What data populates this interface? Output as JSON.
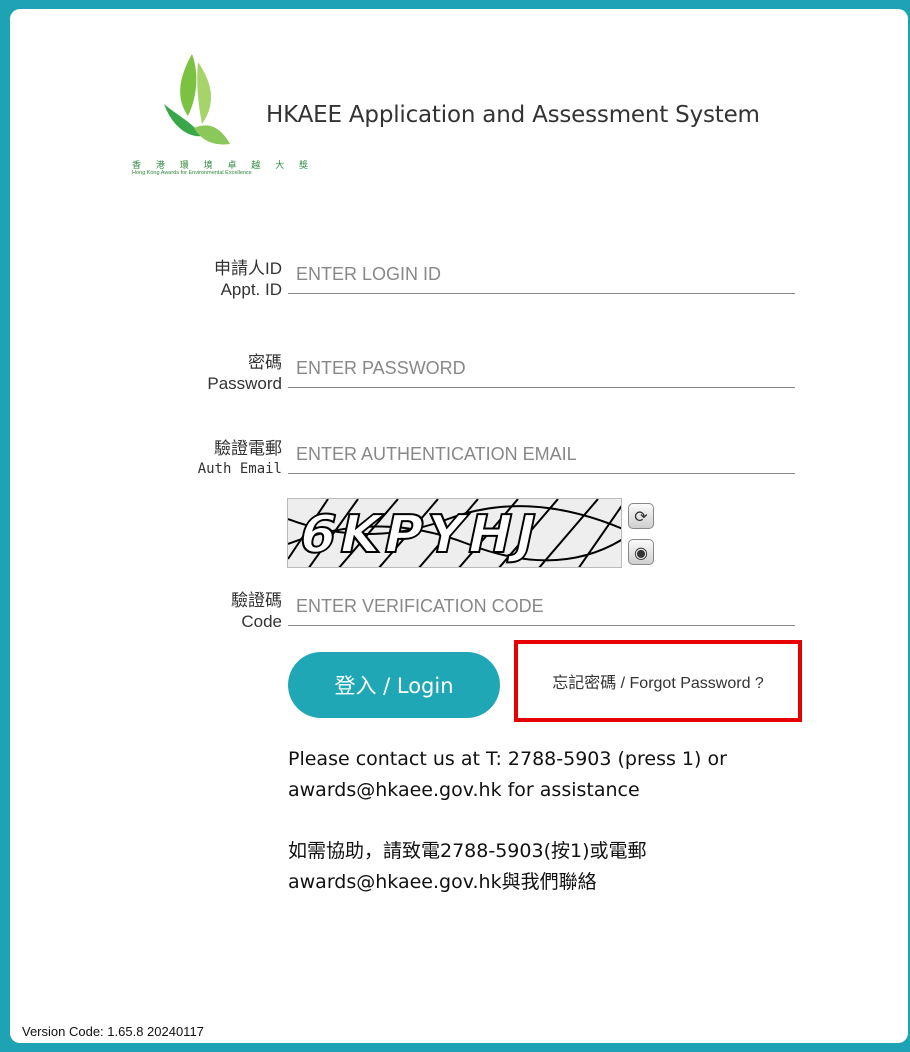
{
  "header": {
    "logo_cn": "香 港 環 境 卓 越 大 獎",
    "logo_en": "Hong Kong Awards for Environmental Excellence",
    "title": "HKAEE Application and Assessment System"
  },
  "form": {
    "login_id": {
      "label_cn": "申請人ID",
      "label_en": "Appt. ID",
      "placeholder": "ENTER LOGIN ID"
    },
    "password": {
      "label_cn": "密碼",
      "label_en": "Password",
      "placeholder": "ENTER PASSWORD"
    },
    "auth_email": {
      "label_cn": "驗證電郵",
      "label_en": "Auth Email",
      "placeholder": "ENTER AUTHENTICATION EMAIL"
    },
    "captcha": {
      "text": "6KPYHJ",
      "refresh_icon": "refresh-icon",
      "audio_icon": "audio-icon"
    },
    "code": {
      "label_cn": "驗證碼",
      "label_en": "Code",
      "placeholder": "ENTER VERIFICATION CODE"
    },
    "login_button": "登入 / Login",
    "forgot_link": "忘記密碼 / Forgot Password ?"
  },
  "contact": {
    "en_line1": "Please contact us at T: 2788-5903 (press 1) or",
    "en_line2": "awards@hkaee.gov.hk for assistance",
    "cn_line1": "如需協助，請致電2788-5903(按1)或電郵",
    "cn_line2": "awards@hkaee.gov.hk與我們聯絡"
  },
  "footer": {
    "version": "Version Code: 1.65.8 20240117"
  },
  "colors": {
    "frame": "#1ea3b4",
    "button": "#20a7b5",
    "highlight": "#e60000",
    "logo_green": "#2d8a3e"
  }
}
